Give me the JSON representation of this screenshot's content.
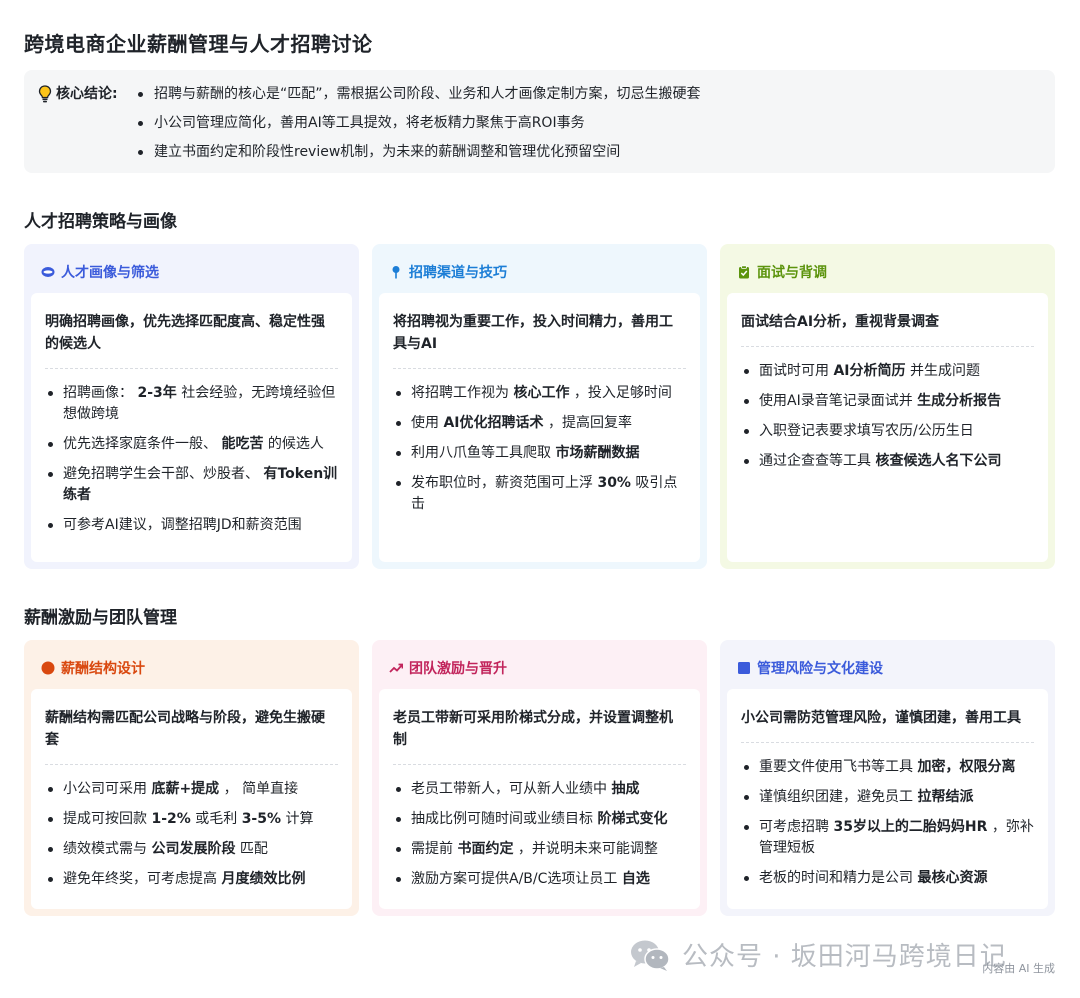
{
  "title": "跨境电商企业薪酬管理与人才招聘讨论",
  "summary": {
    "label": "核心结论:",
    "icon": "lightbulb-icon",
    "items": [
      "招聘与薪酬的核心是“匹配”，需根据公司阶段、业务和人才画像定制方案，切忌生搬硬套",
      "小公司管理应简化，善用AI等工具提效，将老板精力聚焦于高ROI事务",
      "建立书面约定和阶段性review机制，为未来的薪酬调整和管理优化预留空间"
    ]
  },
  "sections": [
    {
      "title": "人才招聘策略与画像",
      "cards": [
        {
          "title": "人才画像与筛选",
          "icon": "ellipse-icon",
          "accent": "#3b5bdb",
          "bg": "#f1f3fd",
          "lead": "明确招聘画像，优先选择匹配度高、稳定性强的候选人",
          "items": [
            [
              {
                "t": "招聘画像： "
              },
              {
                "t": "2-3年",
                "b": true
              },
              {
                "t": " 社会经验，无跨境经验但想做跨境"
              }
            ],
            [
              {
                "t": "优先选择家庭条件一般、 "
              },
              {
                "t": "能吃苦",
                "b": true
              },
              {
                "t": " 的候选人"
              }
            ],
            [
              {
                "t": "避免招聘学生会干部、炒股者、 "
              },
              {
                "t": "有Token训练者",
                "b": true
              }
            ],
            [
              {
                "t": "可参考AI建议，调整招聘JD和薪资范围"
              }
            ]
          ]
        },
        {
          "title": "招聘渠道与技巧",
          "icon": "pin-icon",
          "accent": "#1c7ed6",
          "bg": "#eef7fd",
          "lead": "将招聘视为重要工作，投入时间精力，善用工具与AI",
          "items": [
            [
              {
                "t": "将招聘工作视为 "
              },
              {
                "t": "核心工作",
                "b": true
              },
              {
                "t": " ，投入足够时间"
              }
            ],
            [
              {
                "t": "使用 "
              },
              {
                "t": "AI优化招聘话术",
                "b": true
              },
              {
                "t": " ，提高回复率"
              }
            ],
            [
              {
                "t": "利用八爪鱼等工具爬取 "
              },
              {
                "t": "市场薪酬数据",
                "b": true
              }
            ],
            [
              {
                "t": "发布职位时，薪资范围可上浮 "
              },
              {
                "t": "30%",
                "b": true
              },
              {
                "t": " 吸引点击"
              }
            ]
          ]
        },
        {
          "title": "面试与背调",
          "icon": "clipboard-check-icon",
          "accent": "#5c940d",
          "bg": "#f4f9e4",
          "lead": "面试结合AI分析，重视背景调查",
          "items": [
            [
              {
                "t": "面试时可用 "
              },
              {
                "t": "AI分析简历",
                "b": true
              },
              {
                "t": " 并生成问题"
              }
            ],
            [
              {
                "t": "使用AI录音笔记录面试并 "
              },
              {
                "t": "生成分析报告",
                "b": true
              }
            ],
            [
              {
                "t": "入职登记表要求填写农历/公历生日"
              }
            ],
            [
              {
                "t": "通过企查查等工具 "
              },
              {
                "t": "核查候选人名下公司",
                "b": true
              }
            ]
          ]
        }
      ]
    },
    {
      "title": "薪酬激励与团队管理",
      "cards": [
        {
          "title": "薪酬结构设计",
          "icon": "circle-icon",
          "accent": "#d9480f",
          "bg": "#fdf1e7",
          "lead": "薪酬结构需匹配公司战略与阶段，避免生搬硬套",
          "items": [
            [
              {
                "t": "小公司可采用 "
              },
              {
                "t": "底薪+提成",
                "b": true
              },
              {
                "t": " ， 简单直接"
              }
            ],
            [
              {
                "t": "提成可按回款 "
              },
              {
                "t": "1-2%",
                "b": true
              },
              {
                "t": " 或毛利 "
              },
              {
                "t": "3-5%",
                "b": true
              },
              {
                "t": " 计算"
              }
            ],
            [
              {
                "t": "绩效模式需与 "
              },
              {
                "t": "公司发展阶段",
                "b": true
              },
              {
                "t": " 匹配"
              }
            ],
            [
              {
                "t": "避免年终奖，可考虑提高 "
              },
              {
                "t": "月度绩效比例",
                "b": true
              }
            ]
          ]
        },
        {
          "title": "团队激励与晋升",
          "icon": "trending-up-icon",
          "accent": "#c2255c",
          "bg": "#fdf0f5",
          "lead": "老员工带新可采用阶梯式分成，并设置调整机制",
          "items": [
            [
              {
                "t": "老员工带新人，可从新人业绩中 "
              },
              {
                "t": "抽成",
                "b": true
              }
            ],
            [
              {
                "t": "抽成比例可随时间或业绩目标 "
              },
              {
                "t": "阶梯式变化",
                "b": true
              }
            ],
            [
              {
                "t": "需提前 "
              },
              {
                "t": "书面约定",
                "b": true
              },
              {
                "t": " ，并说明未来可能调整"
              }
            ],
            [
              {
                "t": "激励方案可提供A/B/C选项让员工 "
              },
              {
                "t": "自选",
                "b": true
              }
            ]
          ]
        },
        {
          "title": "管理风险与文化建设",
          "icon": "square-icon",
          "accent": "#3b5bdb",
          "bg": "#f3f4fb",
          "lead": "小公司需防范管理风险，谨慎团建，善用工具",
          "items": [
            [
              {
                "t": "重要文件使用飞书等工具 "
              },
              {
                "t": "加密，权限分离",
                "b": true
              }
            ],
            [
              {
                "t": "谨慎组织团建，避免员工 "
              },
              {
                "t": "拉帮结派",
                "b": true
              }
            ],
            [
              {
                "t": "可考虑招聘 "
              },
              {
                "t": "35岁以上的二胎妈妈HR",
                "b": true
              },
              {
                "t": " ，弥补管理短板"
              }
            ],
            [
              {
                "t": "老板的时间和精力是公司 "
              },
              {
                "t": "最核心资源",
                "b": true
              }
            ]
          ]
        }
      ]
    }
  ],
  "watermark": "公众号 · 坂田河马跨境日记",
  "ai_note": "内容由 AI 生成"
}
